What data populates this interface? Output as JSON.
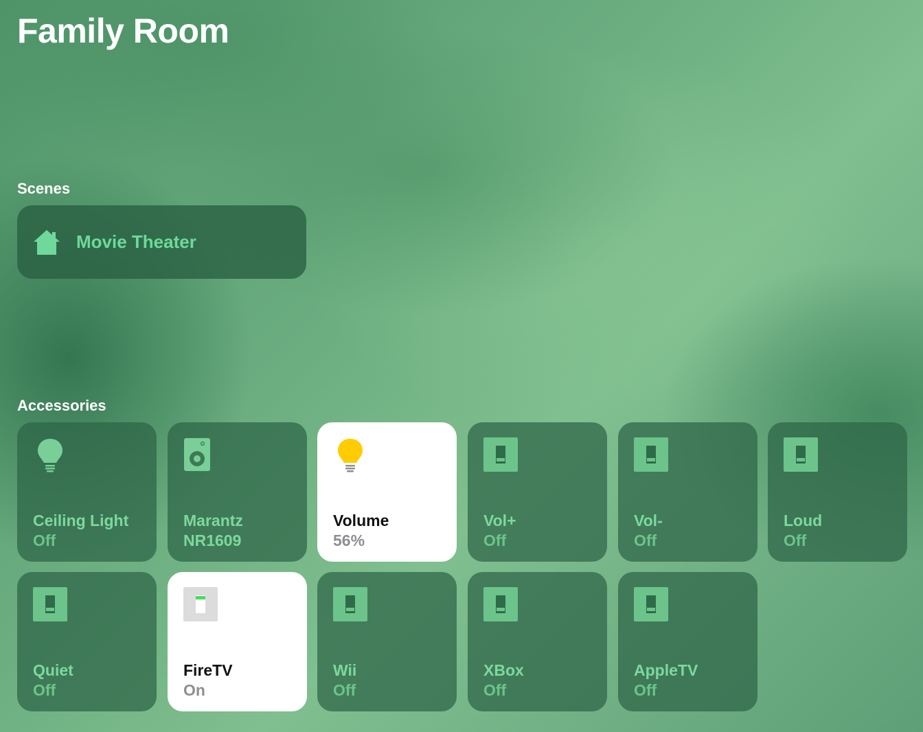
{
  "room": {
    "title": "Family Room"
  },
  "scenes": {
    "heading": "Scenes",
    "items": [
      {
        "label": "Movie Theater",
        "icon": "house-icon"
      }
    ]
  },
  "accessories": {
    "heading": "Accessories",
    "items": [
      {
        "name": "Ceiling Light",
        "status": "Off",
        "icon": "lightbulb-icon",
        "on": false
      },
      {
        "name": "Marantz",
        "name2": "NR1609",
        "status": "",
        "icon": "speaker-icon",
        "on": false
      },
      {
        "name": "Volume",
        "status": "56%",
        "icon": "lightbulb-icon",
        "on": true
      },
      {
        "name": "Vol+",
        "status": "Off",
        "icon": "switch-icon",
        "on": false
      },
      {
        "name": "Vol-",
        "status": "Off",
        "icon": "switch-icon",
        "on": false
      },
      {
        "name": "Loud",
        "status": "Off",
        "icon": "switch-icon",
        "on": false
      },
      {
        "name": "Quiet",
        "status": "Off",
        "icon": "switch-icon",
        "on": false
      },
      {
        "name": "FireTV",
        "status": "On",
        "icon": "switch-icon",
        "on": true
      },
      {
        "name": "Wii",
        "status": "Off",
        "icon": "switch-icon",
        "on": false
      },
      {
        "name": "XBox",
        "status": "Off",
        "icon": "switch-icon",
        "on": false
      },
      {
        "name": "AppleTV",
        "status": "Off",
        "icon": "switch-icon",
        "on": false
      }
    ]
  },
  "colors": {
    "accent_green": "#6fd99b",
    "bulb_on_yellow": "#ffcc00",
    "tile_on": "#ffffff"
  }
}
